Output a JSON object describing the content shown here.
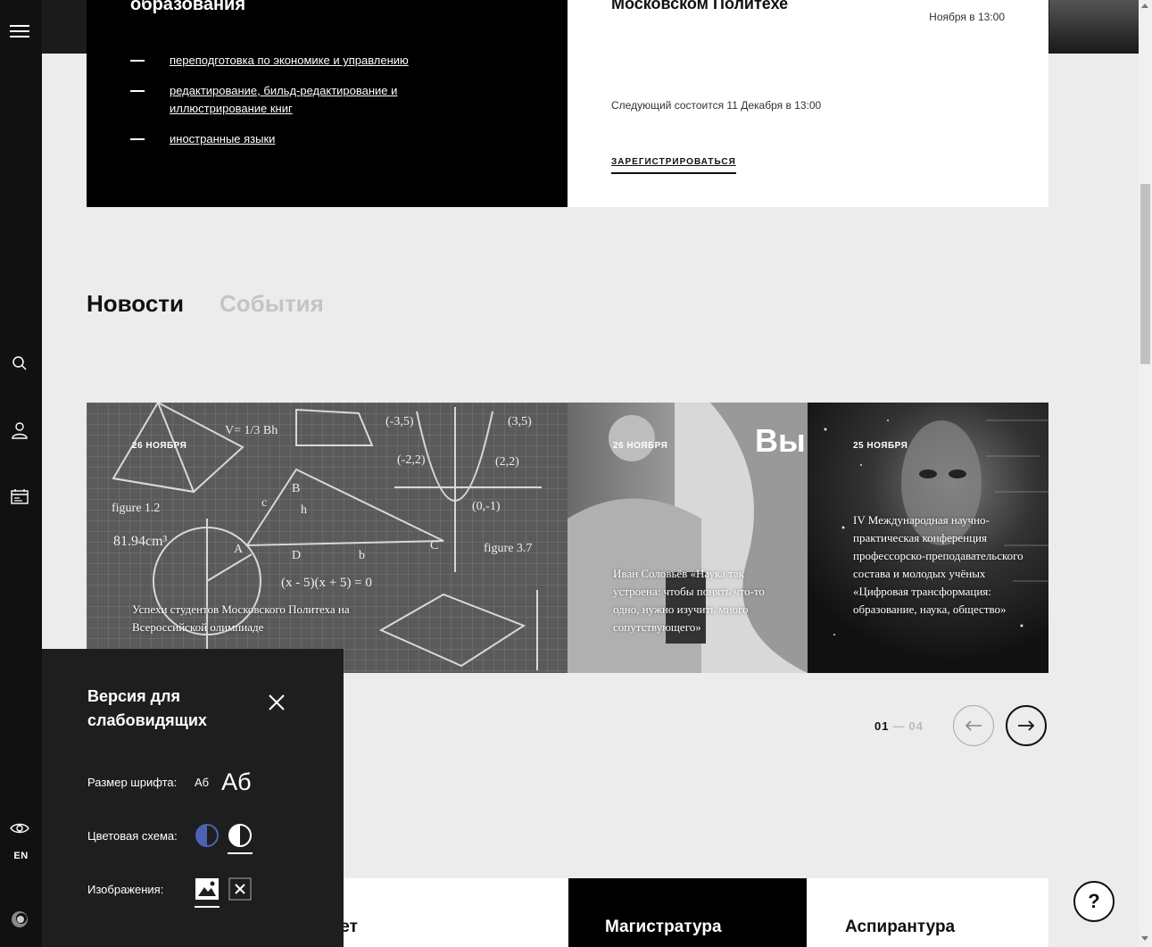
{
  "education": {
    "heading": "образования",
    "links": [
      "переподготовка по экономике и управлению",
      "редактирование, бильд-редактирование и иллюстрирование книг",
      "иностранные языки"
    ]
  },
  "event": {
    "title": "Московском Политехе",
    "time": "Ноября в 13:00",
    "next": "Следующий состоится 11 Декабря в 13:00",
    "register": "ЗАРЕГИСТРИРОВАТЬСЯ"
  },
  "tabs": {
    "news": "Новости",
    "events": "События"
  },
  "news": [
    {
      "date": "26 НОЯБРЯ",
      "title": "Успехи студентов Московского Политеха на Всероссийской олимпиаде"
    },
    {
      "date": "26 НОЯБРЯ",
      "title": "Иван Соловьёв «Наука так устроена: чтобы понять что-то одно, нужно изучить много сопутствующего»"
    },
    {
      "date": "25 НОЯБРЯ",
      "title": "IV Международная научно-практическая конференция профессорско-преподавательского состава и молодых учёных «Цифровая трансформация: образование, наука, общество»"
    }
  ],
  "pager": {
    "current": "01",
    "separator": "—",
    "total": "04"
  },
  "programs": {
    "first": "тет",
    "second": "Магистратура",
    "third": "Аспирантура"
  },
  "help": {
    "label": "?"
  },
  "rail": {
    "lang": "EN"
  },
  "a11y": {
    "title": "Версия для слабовидящих",
    "font_label": "Размер шрифта:",
    "font_small": "Аб",
    "font_big": "Аб",
    "color_label": "Цветовая схема:",
    "images_label": "Изображения:"
  },
  "colors": {
    "accent_scheme": "#4b63b3",
    "rail": "#111111",
    "panel": "#1e1e1e"
  }
}
